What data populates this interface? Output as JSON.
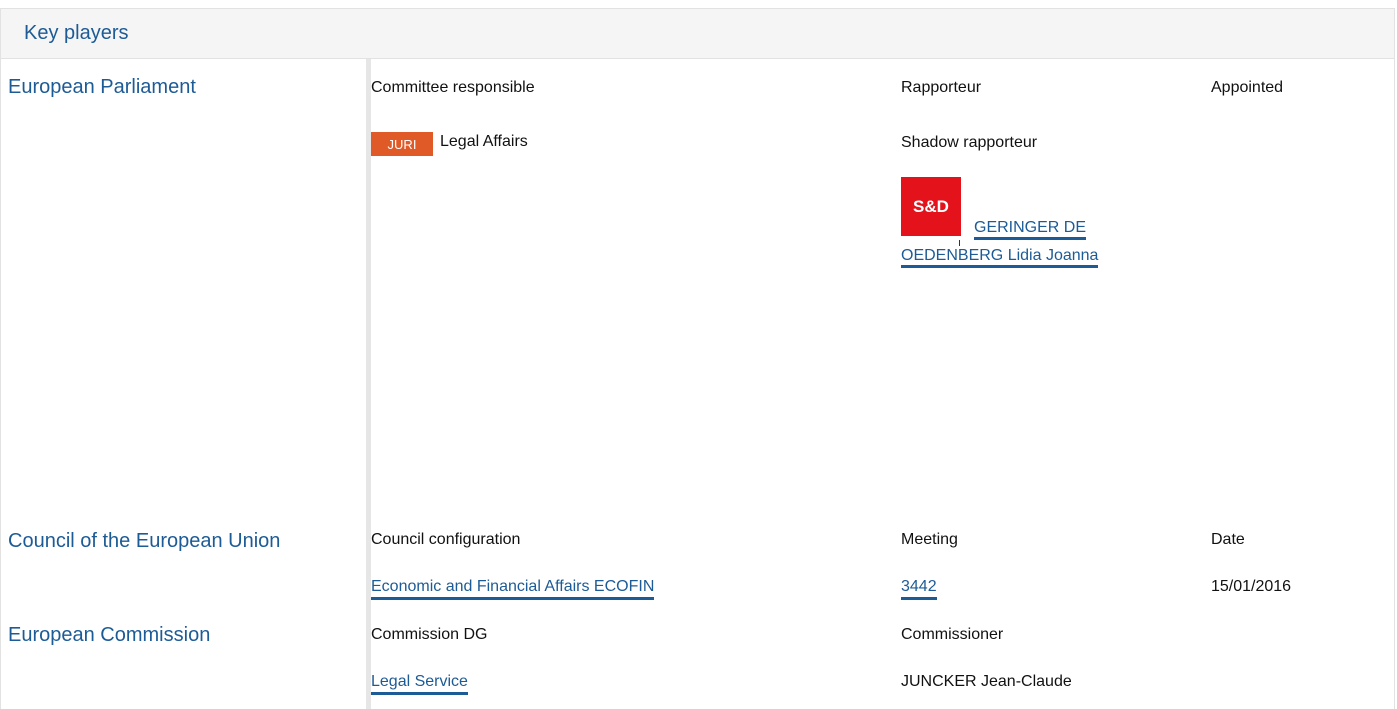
{
  "header": {
    "title": "Key players"
  },
  "european_parliament": {
    "title": "European Parliament",
    "col_committee": "Committee responsible",
    "col_rapporteur": "Rapporteur",
    "col_appointed": "Appointed",
    "committee_badge": "JURI",
    "committee_name": "Legal Affairs",
    "shadow_label": "Shadow rapporteur",
    "group_logo": "S&D",
    "shadow_name_line1": "GERINGER DE",
    "shadow_name_line2": "OEDENBERG Lidia Joanna"
  },
  "council": {
    "title": "Council of the European Union",
    "col_configuration": "Council configuration",
    "col_meeting": "Meeting",
    "col_date": "Date",
    "configuration": "Economic and Financial Affairs ECOFIN",
    "meeting": "3442",
    "date": "15/01/2016"
  },
  "commission": {
    "title": "European Commission",
    "col_dg": "Commission DG",
    "col_commissioner": "Commissioner",
    "dg": "Legal Service",
    "commissioner": "JUNCKER Jean-Claude"
  },
  "colors": {
    "accent": "#1d5b96",
    "juri_badge": "#e05a28",
    "sd_red": "#e3121b"
  }
}
